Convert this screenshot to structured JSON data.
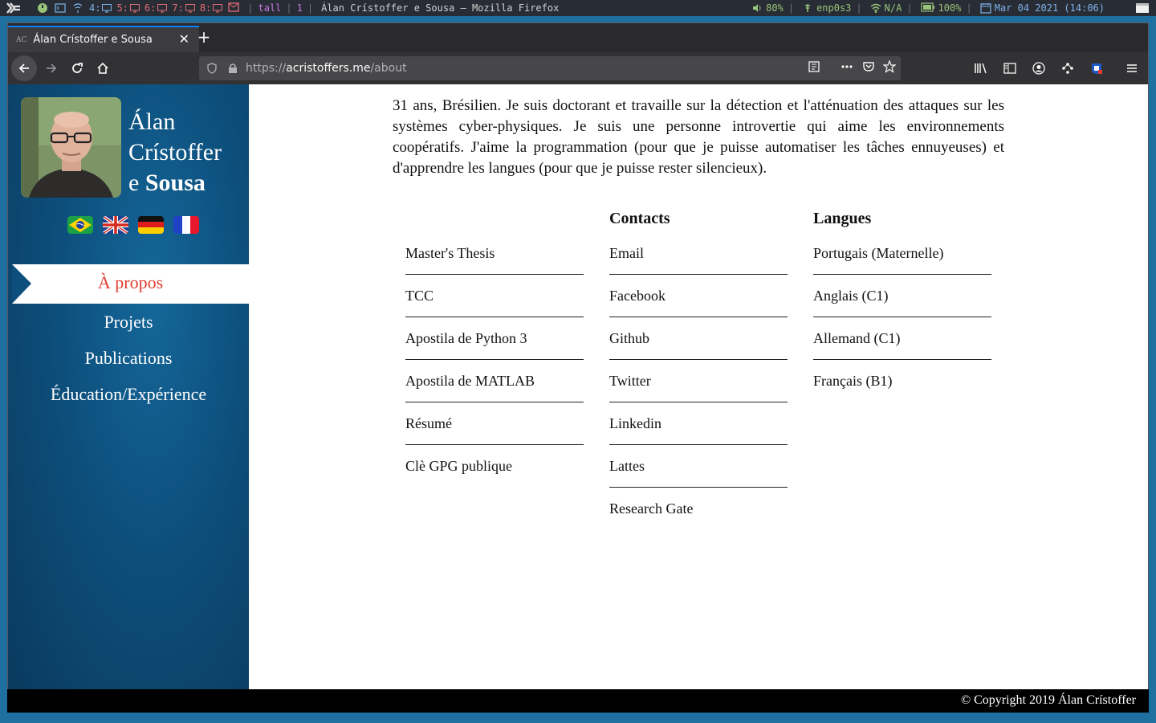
{
  "system": {
    "workspaces": [
      {
        "label": "4:",
        "state": "current"
      },
      {
        "label": "5:",
        "state": "other"
      },
      {
        "label": "6:",
        "state": "other"
      },
      {
        "label": "7:",
        "state": "other"
      },
      {
        "label": "8:",
        "state": "other"
      }
    ],
    "layout": "tall",
    "win_count": "1",
    "window_title": "Álan Crístoffer e Sousa — Mozilla Firefox",
    "volume": "80%",
    "network": "enp0s3",
    "wifi": "N/A",
    "battery": "100%",
    "datetime": "Mar 04 2021 (14:06)"
  },
  "browser": {
    "tab_title": "Álan Crístoffer e Sousa",
    "tab_favicon": "AC",
    "url_scheme": "https://",
    "url_host": "acristoffers.me",
    "url_path": "/about"
  },
  "sidebar": {
    "name_line1": "Álan",
    "name_line2": "Crístoffer",
    "name_line3_plain": "e ",
    "name_line3_bold": "Sousa",
    "flags": [
      "brazil-flag",
      "uk-flag",
      "germany-flag",
      "france-flag"
    ],
    "nav": [
      {
        "label": "À propos",
        "active": true
      },
      {
        "label": "Projets",
        "active": false
      },
      {
        "label": "Publications",
        "active": false
      },
      {
        "label": "Éducation/Expérience",
        "active": false
      }
    ]
  },
  "main": {
    "intro": "31 ans, Brésilien. Je suis doctorant et travaille sur la détection et l'atténuation des attaques sur les systèmes cyber-physiques. Je suis une personne introvertie qui aime les environnements coopératifs. J'aime la programmation (pour que je puisse automatiser les tâches ennuyeuses) et d'apprendre les langues (pour que je puisse rester silencieux).",
    "documents": [
      "Master's Thesis",
      "TCC",
      "Apostila de Python 3",
      "Apostila de MATLAB",
      "Résumé",
      "Clè GPG publique"
    ],
    "contacts_title": "Contacts",
    "contacts": [
      "Email",
      "Facebook",
      "Github",
      "Twitter",
      "Linkedin",
      "Lattes",
      "Research Gate"
    ],
    "languages_title": "Langues",
    "languages": [
      "Portugais (Maternelle)",
      "Anglais (C1)",
      "Allemand (C1)",
      "Français (B1)"
    ]
  },
  "footer": {
    "copyright": "© Copyright 2019 Álan Crístoffer"
  }
}
